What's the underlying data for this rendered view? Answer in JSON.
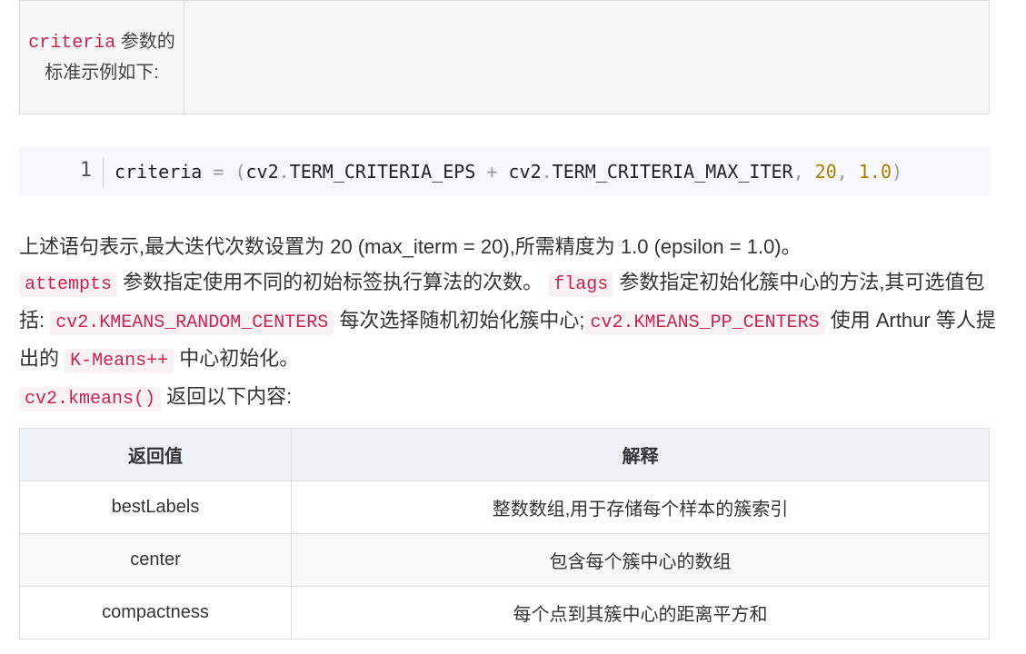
{
  "top_table": {
    "code": "criteria",
    "text": " 参数的标准示例如下:"
  },
  "code_block": {
    "line_number": "1",
    "tokens": {
      "t1": "criteria",
      "t2": " = ",
      "t3": "(",
      "t4": "cv2",
      "t5": ".",
      "t6": "TERM_CRITERIA_EPS",
      "t7": " + ",
      "t8": "cv2",
      "t9": ".",
      "t10": "TERM_CRITERIA_MAX_ITER",
      "t11": ", ",
      "t12": "20",
      "t13": ", ",
      "t14": "1.0",
      "t15": ")"
    }
  },
  "paragraph": {
    "s1": "上述语句表示,最大迭代次数设置为 20 (max_iterm = 20),所需精度为 1.0 (epsilon = 1.0)。",
    "c1": "attempts",
    "s2": " 参数指定使用不同的初始标签执行算法的次数。",
    "c2": "flags",
    "s3": " 参数指定初始化簇中心的方法,其可选值包括:",
    "c3": "cv2.KMEANS_RANDOM_CENTERS",
    "s4": " 每次选择随机初始化簇中心;",
    "c4": "cv2.KMEANS_PP_CENTERS",
    "s5": " 使用 Arthur 等人提出的 ",
    "c5": "K-Means++",
    "s6": " 中心初始化。",
    "c6": "cv2.kmeans()",
    "s7": " 返回以下内容:"
  },
  "return_table": {
    "headers": [
      "返回值",
      "解释"
    ],
    "rows": [
      [
        "bestLabels",
        "整数数组,用于存储每个样本的簇索引"
      ],
      [
        "center",
        "包含每个簇中心的数组"
      ],
      [
        "compactness",
        "每个点到其簇中心的距离平方和"
      ]
    ]
  }
}
